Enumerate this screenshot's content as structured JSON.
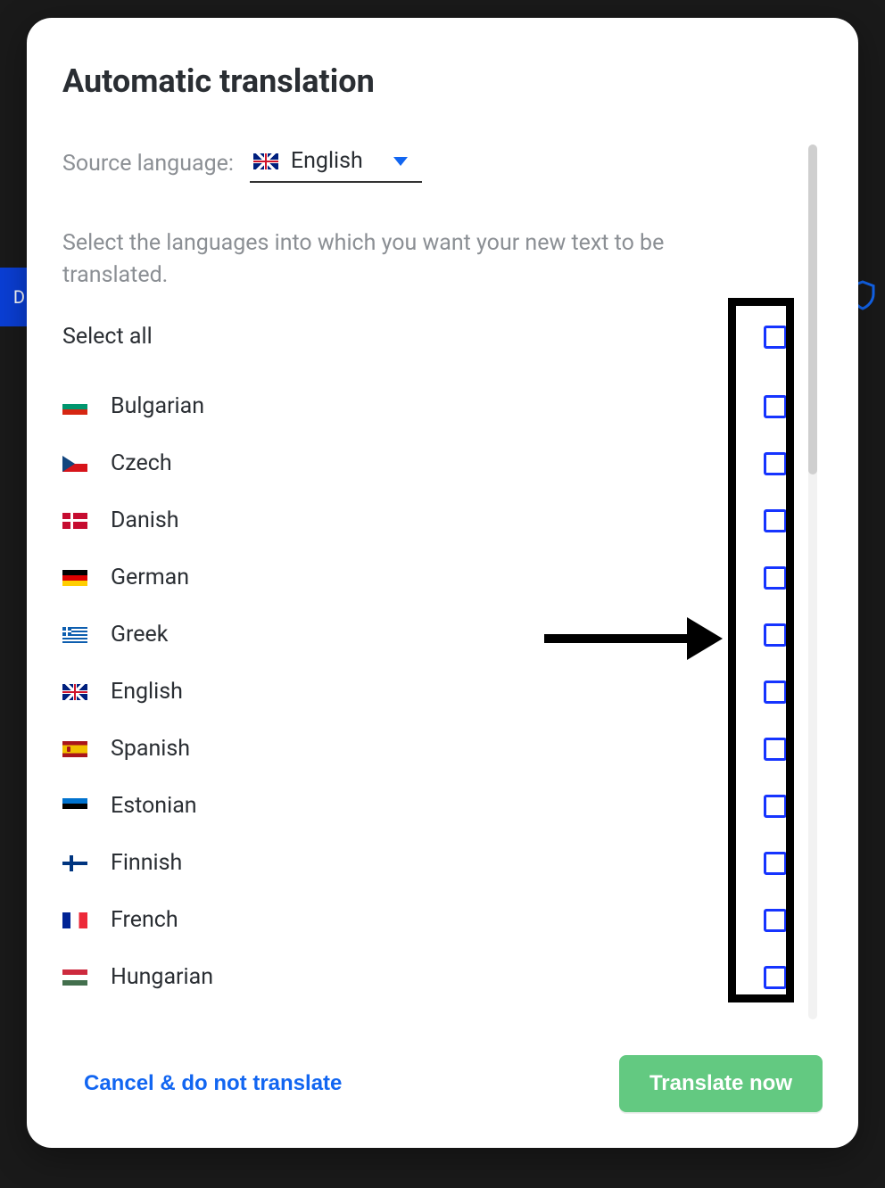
{
  "modal": {
    "title": "Automatic translation",
    "source_label": "Source language:",
    "source_value": "English",
    "instruction": "Select the languages into which you want your new text to be translated.",
    "select_all_label": "Select all",
    "languages": [
      {
        "name": "Bulgarian",
        "flag": "flag-bg",
        "checked": false
      },
      {
        "name": "Czech",
        "flag": "flag-cz",
        "checked": false
      },
      {
        "name": "Danish",
        "flag": "flag-dk",
        "checked": false
      },
      {
        "name": "German",
        "flag": "flag-de",
        "checked": false
      },
      {
        "name": "Greek",
        "flag": "flag-gr",
        "checked": false
      },
      {
        "name": "English",
        "flag": "flag-gb",
        "checked": false
      },
      {
        "name": "Spanish",
        "flag": "flag-es",
        "checked": false
      },
      {
        "name": "Estonian",
        "flag": "flag-ee",
        "checked": false
      },
      {
        "name": "Finnish",
        "flag": "flag-fi",
        "checked": false
      },
      {
        "name": "French",
        "flag": "flag-fr",
        "checked": false
      },
      {
        "name": "Hungarian",
        "flag": "flag-hu",
        "checked": false
      }
    ]
  },
  "footer": {
    "cancel_label": "Cancel & do not translate",
    "translate_label": "Translate now"
  },
  "annotations": {
    "highlight_target": "language-checkbox-column",
    "arrow_target": "language-checkbox-column"
  }
}
